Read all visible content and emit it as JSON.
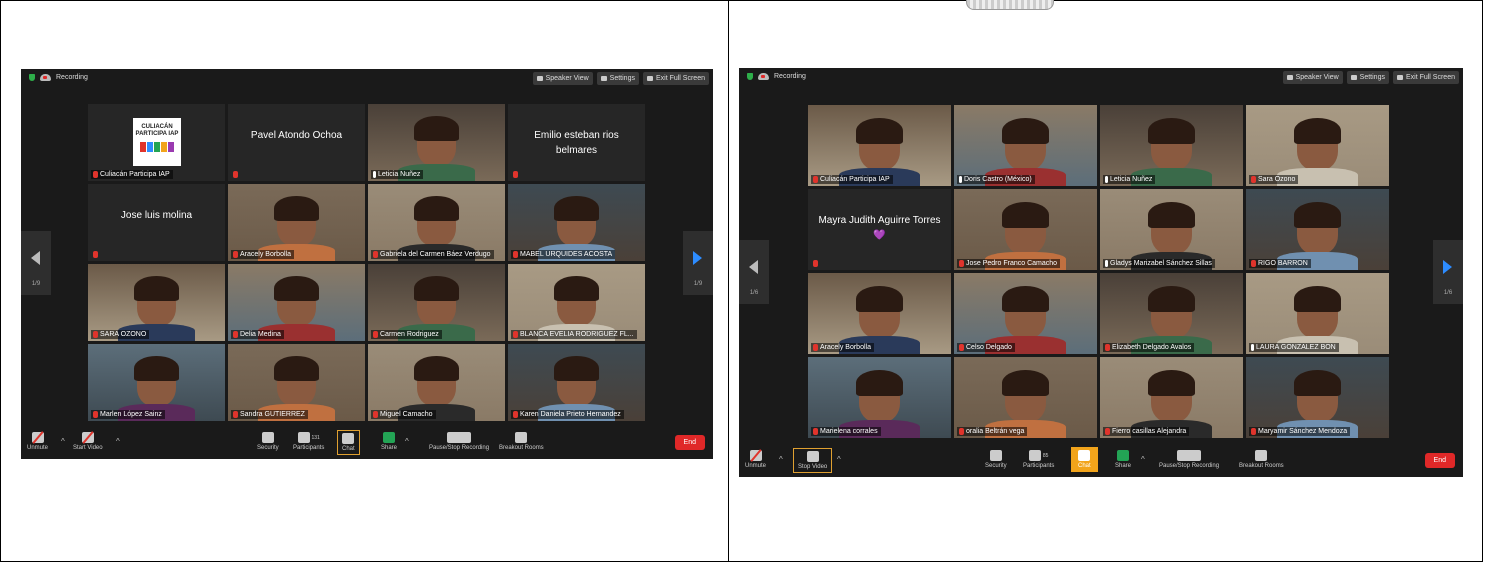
{
  "left": {
    "recording_label": "Recording",
    "top_buttons": [
      "Speaker View",
      "Settings",
      "Exit Full Screen"
    ],
    "page": "1/9",
    "page_right": "1/9",
    "tiles": [
      {
        "name": "Culiacán Participa IAP",
        "type": "logo",
        "logo_text": "CULIACÁN PARTICIPA IAP"
      },
      {
        "name": "",
        "type": "text",
        "big": "Pavel Atondo Ochoa"
      },
      {
        "name": "Leticia Nuñez",
        "type": "video",
        "highlight": true,
        "mic": true
      },
      {
        "name": "",
        "type": "text",
        "big": "Emilio esteban rios belmares"
      },
      {
        "name": "",
        "type": "text",
        "big": "Jose luis molina"
      },
      {
        "name": "Aracely Borbolla",
        "type": "video"
      },
      {
        "name": "Gabriela del Carmen Báez Verdugo",
        "type": "video"
      },
      {
        "name": "MABEL URQUIDES ACOSTA",
        "type": "video"
      },
      {
        "name": "SARA OZONO",
        "type": "video"
      },
      {
        "name": "Delia Medina",
        "type": "video"
      },
      {
        "name": "Carmen Rodriguez",
        "type": "video"
      },
      {
        "name": "BLANCA EVELIA RODRIGUEZ FL...",
        "type": "video"
      },
      {
        "name": "Marlen López Sainz",
        "type": "video"
      },
      {
        "name": "Sandra GUTIERREZ",
        "type": "video"
      },
      {
        "name": "Miguel Camacho",
        "type": "video"
      },
      {
        "name": "Karen Daniela Prieto Hernandez",
        "type": "video"
      }
    ],
    "bottom": {
      "unmute": "Unmute",
      "start_video": "Start Video",
      "security": "Security",
      "participants": "Participants",
      "participant_count": "131",
      "chat": "Chat",
      "share": "Share",
      "recording": "Pause/Stop Recording",
      "breakout": "Breakout Rooms",
      "end": "End"
    }
  },
  "right": {
    "recording_label": "Recording",
    "top_buttons": [
      "Speaker View",
      "Settings",
      "Exit Full Screen"
    ],
    "page": "1/6",
    "page_right": "1/6",
    "tiles": [
      {
        "name": "Culiacán Participa IAP",
        "type": "video"
      },
      {
        "name": "Doris Castro (México)",
        "type": "video",
        "mic": true
      },
      {
        "name": "Leticia Nuñez",
        "type": "video",
        "mic": true
      },
      {
        "name": "Sara Ozono",
        "type": "video"
      },
      {
        "name": "",
        "type": "text",
        "big": "Mayra Judith Aguirre Torres💜"
      },
      {
        "name": "Jose Pedro Franco Camacho",
        "type": "video"
      },
      {
        "name": "Gladys Marizabel Sánchez Sillas",
        "type": "video",
        "highlight": true,
        "mic": true
      },
      {
        "name": "RIGO BARRON",
        "type": "video"
      },
      {
        "name": "Aracely Borbolla",
        "type": "video"
      },
      {
        "name": "Celso Delgado",
        "type": "video"
      },
      {
        "name": "Elizabeth Delgado Avalos",
        "type": "video"
      },
      {
        "name": "LAURA GONZALEZ BON",
        "type": "video",
        "mic": true
      },
      {
        "name": "Marielena corrales",
        "type": "video"
      },
      {
        "name": "oralia Beltrán vega",
        "type": "video"
      },
      {
        "name": "Fierro casillas Alejandra",
        "type": "video"
      },
      {
        "name": "Maryamir Sánchez Mendoza",
        "type": "video"
      }
    ],
    "bottom": {
      "unmute": "Unmute",
      "stop_video": "Stop Video",
      "security": "Security",
      "participants": "Participants",
      "participant_count": "85",
      "chat": "Chat",
      "share": "Share",
      "recording": "Pause/Stop Recording",
      "breakout": "Breakout Rooms",
      "end": "End"
    }
  },
  "colors": {
    "highlight_border": "#c8d46a",
    "end_button": "#e02828",
    "chat_active": "#f2a41b",
    "next_arrow": "#2d8cff",
    "muted_red": "#e0342c"
  }
}
